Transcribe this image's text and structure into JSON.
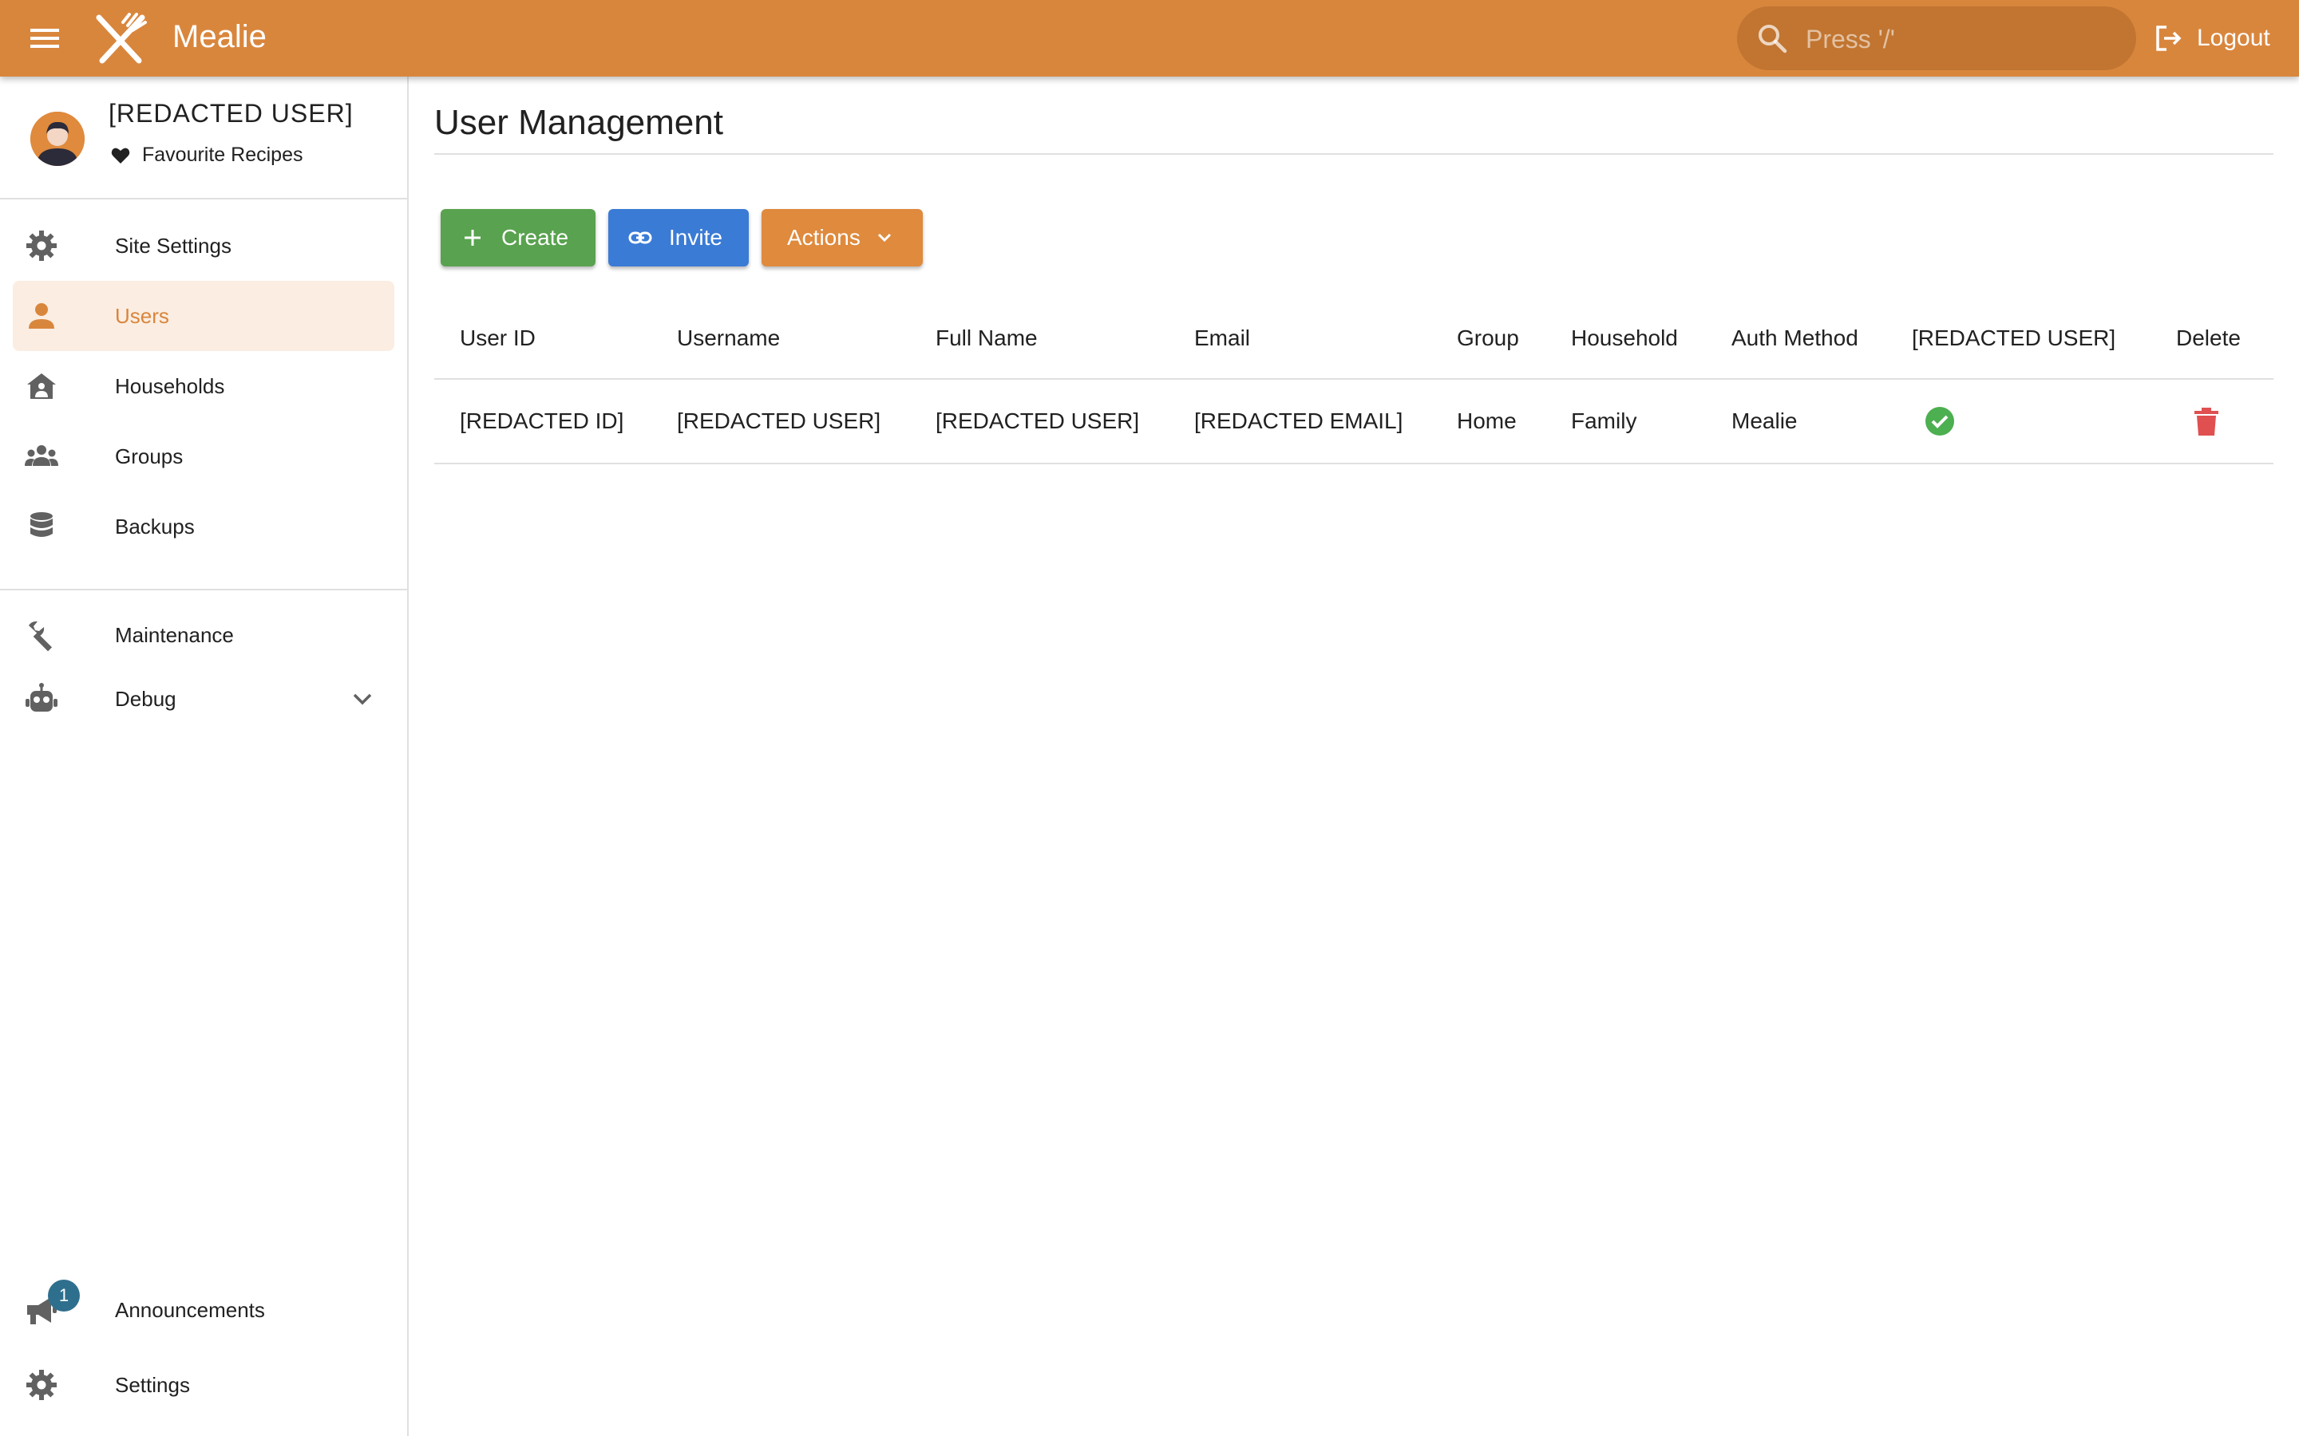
{
  "topbar": {
    "app_title": "Mealie",
    "search_placeholder": "Press '/'",
    "logout_label": "Logout",
    "brand_color": "#D9863D"
  },
  "sidebar": {
    "user_name": "[REDACTED USER]",
    "favourites_label": "Favourite Recipes",
    "items": [
      {
        "label": "Site Settings",
        "icon": "gear-icon"
      },
      {
        "label": "Users",
        "icon": "account-icon",
        "active": true
      },
      {
        "label": "Households",
        "icon": "home-group-icon"
      },
      {
        "label": "Groups",
        "icon": "account-group-icon"
      },
      {
        "label": "Backups",
        "icon": "database-icon"
      }
    ],
    "tools": [
      {
        "label": "Maintenance",
        "icon": "wrench-icon"
      },
      {
        "label": "Debug",
        "icon": "robot-icon",
        "expandable": true
      }
    ],
    "footer": [
      {
        "label": "Announcements",
        "icon": "bullhorn-icon",
        "badge": "1"
      },
      {
        "label": "Settings",
        "icon": "gear-icon"
      }
    ]
  },
  "main": {
    "title": "User Management",
    "buttons": {
      "create": "Create",
      "invite": "Invite",
      "actions": "Actions"
    },
    "table": {
      "headers": [
        "User ID",
        "Username",
        "Full Name",
        "Email",
        "Group",
        "Household",
        "Auth Method",
        "[REDACTED USER]",
        "Delete"
      ],
      "rows": [
        {
          "user_id": "[REDACTED ID]",
          "username": "[REDACTED USER]",
          "full_name": "[REDACTED USER]",
          "email": "[REDACTED EMAIL]",
          "group": "Home",
          "household": "Family",
          "auth_method": "Mealie",
          "admin": true
        }
      ]
    }
  },
  "colors": {
    "create": "#59A24F",
    "invite": "#3A7BD5",
    "actions": "#DF8A3D",
    "check": "#4CAF50",
    "delete": "#E05050",
    "badge": "#2F6F8E"
  }
}
